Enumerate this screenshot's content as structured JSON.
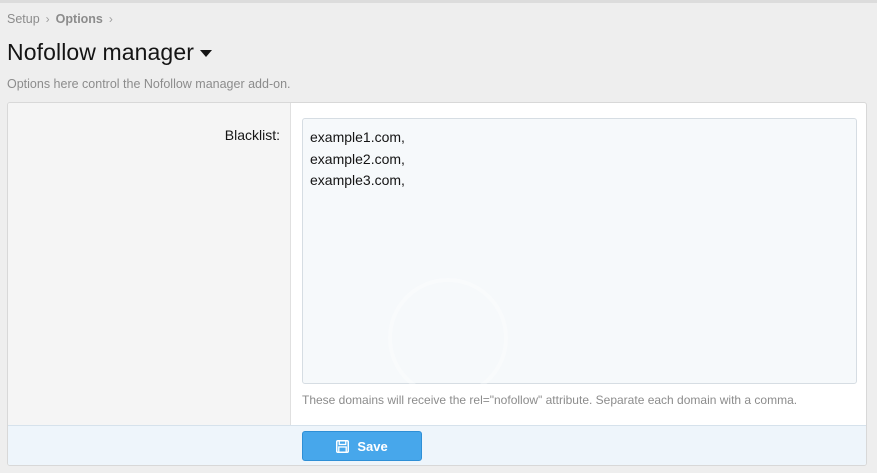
{
  "breadcrumb": {
    "items": [
      "Setup",
      "Options"
    ]
  },
  "header": {
    "title": "Nofollow manager",
    "description": "Options here control the Nofollow manager add-on."
  },
  "form": {
    "blacklist_label": "Blacklist:",
    "blacklist_value": "example1.com,\nexample2.com,\nexample3.com,",
    "explain": "These domains will receive the rel=\"nofollow\" attribute. Separate each domain with a comma."
  },
  "submit": {
    "save_label": "Save"
  },
  "colors": {
    "accent": "#47a7eb",
    "page_bg": "#eeeeee",
    "muted_text": "#8c8c8c"
  }
}
